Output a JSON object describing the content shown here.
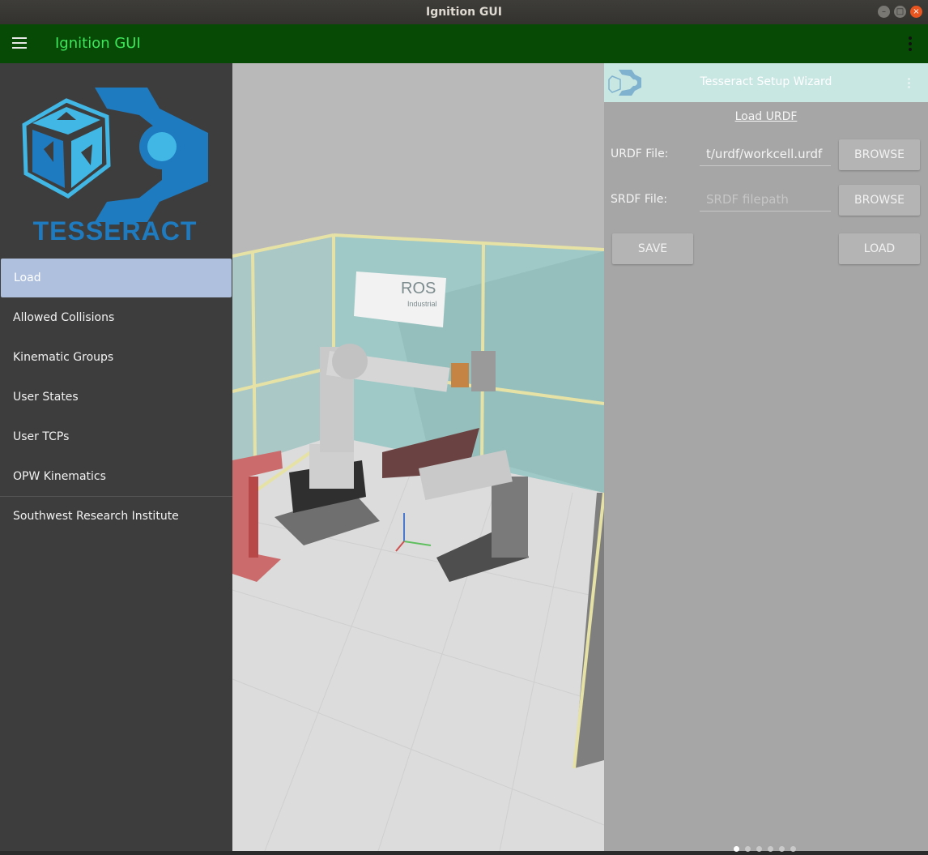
{
  "window": {
    "title": "Ignition GUI"
  },
  "appbar": {
    "title": "Ignition GUI",
    "menu_icon": "hamburger-menu-icon",
    "overflow_icon": "vertical-dots-icon"
  },
  "drawer": {
    "logo_text": "TESSERACT",
    "items": [
      {
        "label": "Load"
      },
      {
        "label": "Allowed Collisions"
      },
      {
        "label": "Kinematic Groups"
      },
      {
        "label": "User States"
      },
      {
        "label": "User TCPs"
      },
      {
        "label": "OPW Kinematics"
      },
      {
        "label": "Southwest Research Institute"
      }
    ],
    "active_index": 0
  },
  "viewport": {
    "poster_text": "ROS",
    "poster_subtext": "Industrial"
  },
  "wizard": {
    "title": "Tesseract Setup Wizard",
    "section_title": "Load URDF",
    "urdf": {
      "label": "URDF File:",
      "value": "t/urdf/workcell.urdf",
      "browse_label": "BROWSE"
    },
    "srdf": {
      "label": "SRDF File:",
      "placeholder": "SRDF filepath",
      "value": "",
      "browse_label": "BROWSE"
    },
    "save_label": "SAVE",
    "load_label": "LOAD",
    "page_count": 6,
    "current_page": 1
  },
  "colors": {
    "appbar": "#064a06",
    "appbar_title": "#3ee65a",
    "drawer": "#3d3d3d",
    "active_item": "#aec0dd",
    "wizard_header": "#c8e6e2",
    "wizard_body": "#a6a6a6",
    "logo_blue": "#1f7bc0"
  }
}
